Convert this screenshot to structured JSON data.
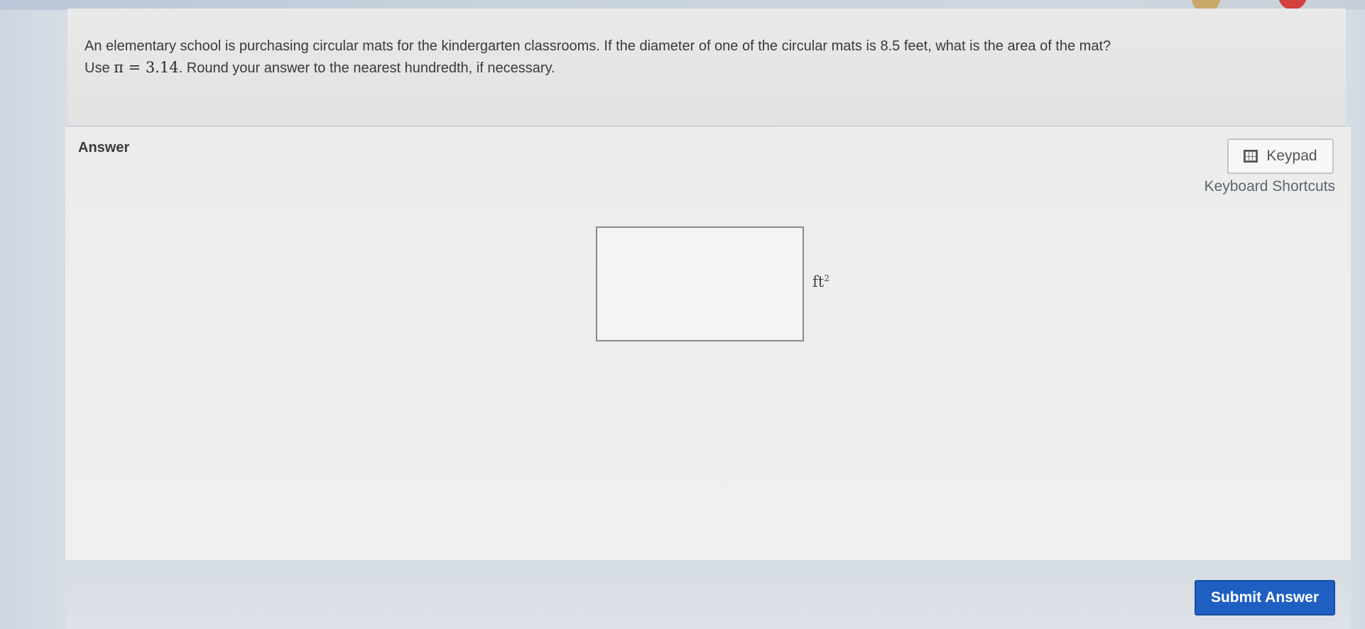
{
  "question": {
    "line1": "An elementary school is purchasing circular mats for the kindergarten classrooms. If the diameter of one of the circular mats is 8.5 feet, what is the area of the mat?",
    "line2_prefix": "Use ",
    "pi_expression": "π = 3.14",
    "line2_suffix": ". Round your answer to the nearest hundredth, if necessary."
  },
  "answer": {
    "label": "Answer",
    "input_value": "",
    "unit_base": "ft",
    "unit_exponent": "2"
  },
  "tools": {
    "keypad_label": "Keypad",
    "keypad_icon": "calculator-icon",
    "shortcuts_label": "Keyboard Shortcuts"
  },
  "footer": {
    "submit_label": "Submit Answer"
  },
  "colors": {
    "submit_button": "#1f5fc2",
    "panel_background": "#ececea"
  }
}
